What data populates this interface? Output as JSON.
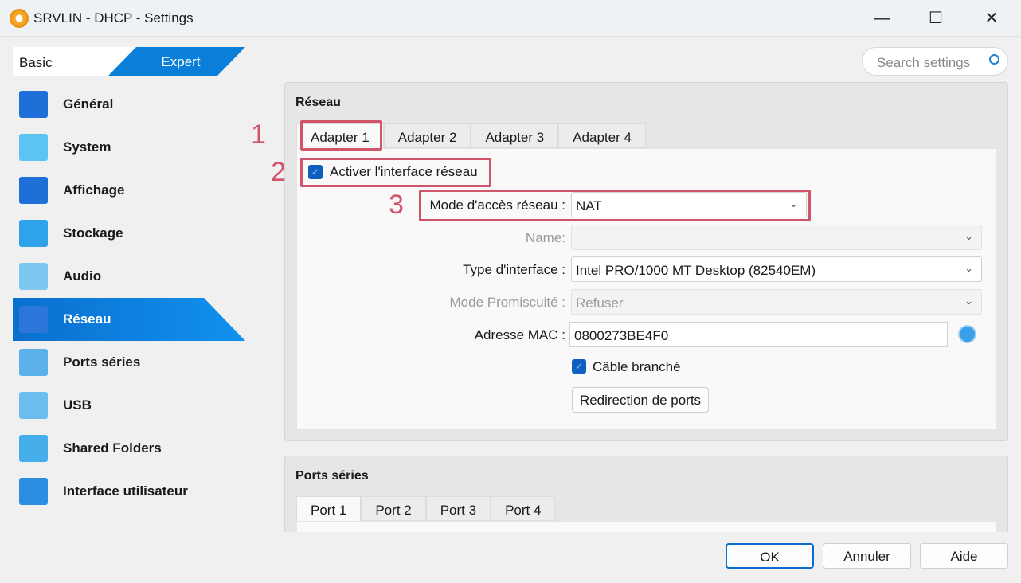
{
  "window": {
    "title": "SRVLIN - DHCP - Settings",
    "minimize": "—",
    "maximize": "☐",
    "close": "✕"
  },
  "mode": {
    "basic": "Basic",
    "expert": "Expert"
  },
  "search": {
    "placeholder": "Search settings"
  },
  "sidebar": {
    "items": [
      {
        "label": "Général",
        "icon": "monitor-icon",
        "color": "#1f6fd8"
      },
      {
        "label": "System",
        "icon": "chip-icon",
        "color": "#5cc4f2"
      },
      {
        "label": "Affichage",
        "icon": "display-icon",
        "color": "#1f6fd8"
      },
      {
        "label": "Stockage",
        "icon": "disk-icon",
        "color": "#2ea3ec"
      },
      {
        "label": "Audio",
        "icon": "speaker-icon",
        "color": "#7cc8f0"
      },
      {
        "label": "Réseau",
        "icon": "network-icon",
        "color": "#2b76d8",
        "selected": true
      },
      {
        "label": "Ports séries",
        "icon": "serial-port-icon",
        "color": "#5bb2ea"
      },
      {
        "label": "USB",
        "icon": "usb-icon",
        "color": "#6bbdf0"
      },
      {
        "label": "Shared Folders",
        "icon": "folder-icon",
        "color": "#46aeea"
      },
      {
        "label": "Interface utilisateur",
        "icon": "ui-window-icon",
        "color": "#2b8ee0"
      }
    ]
  },
  "network": {
    "title": "Réseau",
    "tabs": [
      "Adapter 1",
      "Adapter 2",
      "Adapter 3",
      "Adapter 4"
    ],
    "enable_label": "Activer l'interface réseau",
    "mode_label": "Mode d'accès réseau :",
    "mode_value": "NAT",
    "name_label": "Name:",
    "name_value": "",
    "type_label": "Type d'interface :",
    "type_value": "Intel PRO/1000 MT Desktop (82540EM)",
    "promisc_label": "Mode Promiscuité :",
    "promisc_value": "Refuser",
    "mac_label": "Adresse MAC :",
    "mac_value": "0800273BE4F0",
    "cable_label": "Câble branché",
    "port_fwd": "Redirection de ports"
  },
  "annotations": [
    "1",
    "2",
    "3"
  ],
  "serial": {
    "title": "Ports séries",
    "tabs": [
      "Port 1",
      "Port 2",
      "Port 3",
      "Port 4"
    ]
  },
  "footer": {
    "ok": "OK",
    "cancel": "Annuler",
    "help": "Aide"
  },
  "colors": {
    "accent": "#0a7fd9",
    "highlight": "#d0546a"
  }
}
